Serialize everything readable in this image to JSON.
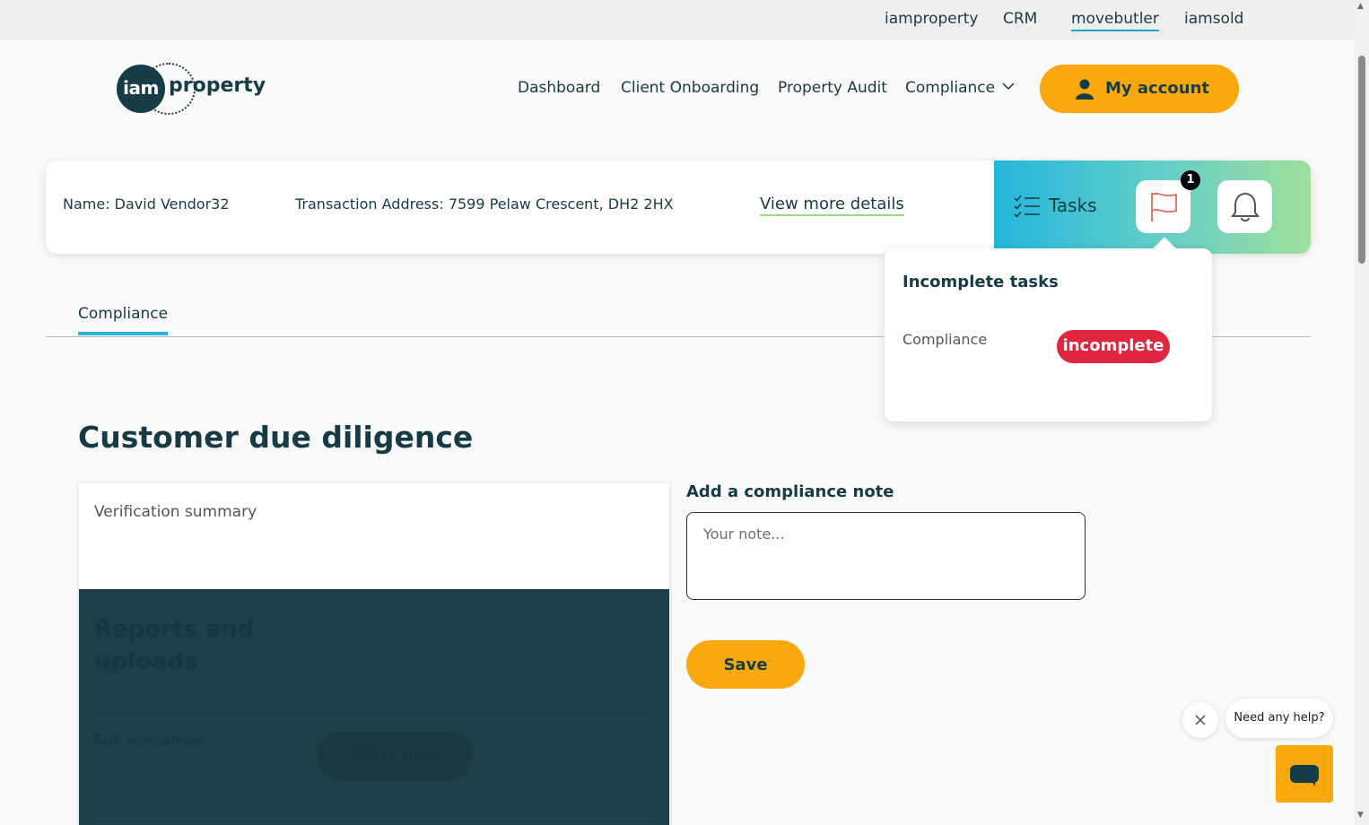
{
  "topbar": {
    "links": [
      "iamproperty",
      "CRM",
      "movebutler",
      "iamsold"
    ],
    "active": "movebutler"
  },
  "header": {
    "logo_badge": "iam",
    "logo_word": "property",
    "nav": [
      "Dashboard",
      "Client Onboarding",
      "Property Audit",
      "Compliance"
    ],
    "account_button": "My account"
  },
  "transaction": {
    "name": "Name: David Vendor32",
    "address": "Transaction Address: 7599 Pelaw Crescent, DH2 2HX",
    "more_link": "View more details",
    "tasks_label": "Tasks",
    "flag_count": "1"
  },
  "tasks_dropdown": {
    "title": "Incomplete tasks",
    "items": [
      {
        "name": "Compliance",
        "status": "incomplete"
      }
    ]
  },
  "tabs": [
    "Compliance"
  ],
  "page_title": "Customer due diligence",
  "verification": {
    "summary_title": "Verification summary",
    "reports_title": "Reports and uploads",
    "risk_label": "Risk assessment",
    "start_button": "Start now"
  },
  "note": {
    "label": "Add a compliance note",
    "placeholder": "Your note...",
    "value": "",
    "save_button": "Save"
  },
  "help": {
    "bubble": "Need any help?"
  },
  "colors": {
    "brand_dark": "#173b44",
    "accent_orange": "#f9a80e",
    "status_red": "#e0253e",
    "tab_underline": "#27b6d7"
  },
  "icons": [
    "tasks-list-icon",
    "flag-icon",
    "bell-icon",
    "person-icon",
    "chevron-down-icon",
    "close-icon",
    "chat-icon"
  ]
}
